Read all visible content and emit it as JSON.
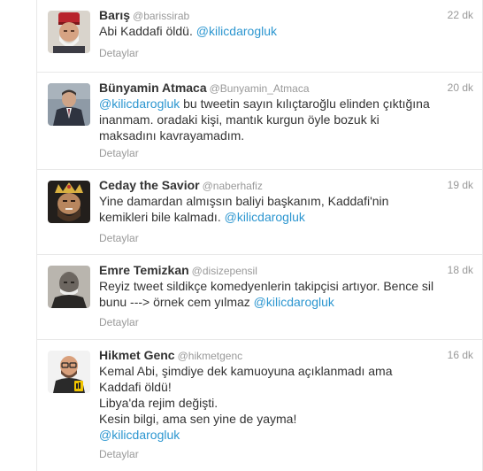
{
  "tweets": [
    {
      "fullname": "Barış",
      "username": "@barissirab",
      "time": "22 dk",
      "lines": [
        {
          "text": "Abi Kaddafi öldü. ",
          "mention": "@kilicdarogluk"
        }
      ],
      "details": "Detaylar",
      "avatar": "avatar-man-red-fez"
    },
    {
      "fullname": "Bünyamin Atmaca",
      "username": "@Bunyamin_Atmaca",
      "time": "20 dk",
      "lines": [
        {
          "mention": "@kilicdarogluk",
          "text": " bu tweetin sayın kılıçtaroğlu elinden çıktığına"
        },
        {
          "text": "inanmam. oradaki kişi, mantık kurgun öyle bozuk ki"
        },
        {
          "text": "maksadını kavrayamadım."
        }
      ],
      "details": "Detaylar",
      "avatar": "avatar-man-suit"
    },
    {
      "fullname": "Ceday the Savior",
      "username": "@naberhafiz",
      "time": "19 dk",
      "lines": [
        {
          "text": "Yine damardan almışsın baliyi başkanım, Kaddafi'nin"
        },
        {
          "text": "kemikleri bile kalmadı. ",
          "mention": "@kilicdarogluk"
        }
      ],
      "details": "Detaylar",
      "avatar": "avatar-man-crown"
    },
    {
      "fullname": "Emre Temizkan",
      "username": "@disizepensil",
      "time": "18 dk",
      "lines": [
        {
          "text": "Reyiz tweet sildikçe komedyenlerin takipçisi artıyor. Bence sil"
        },
        {
          "text": "bunu ---> örnek cem yılmaz ",
          "mention": "@kilicdarogluk"
        }
      ],
      "details": "Detaylar",
      "avatar": "avatar-old-man-portrait"
    },
    {
      "fullname": "Hikmet Genc",
      "username": "@hikmetgenc",
      "time": "16 dk",
      "lines": [
        {
          "text": "Kemal Abi, şimdiye dek kamuoyuna açıklanmadı ama"
        },
        {
          "text": "Kaddafi öldü!"
        },
        {
          "text": "Libya'da rejim değişti."
        },
        {
          "text": "Kesin bilgi, ama sen yine de yayma!"
        },
        {
          "mention": "@kilicdarogluk"
        }
      ],
      "details": "Detaylar",
      "avatar": "avatar-bald-man-glasses"
    }
  ],
  "colors": {
    "mention": "#2c96d0",
    "meta": "#999999",
    "text": "#333333",
    "border": "#e8e8e8"
  }
}
